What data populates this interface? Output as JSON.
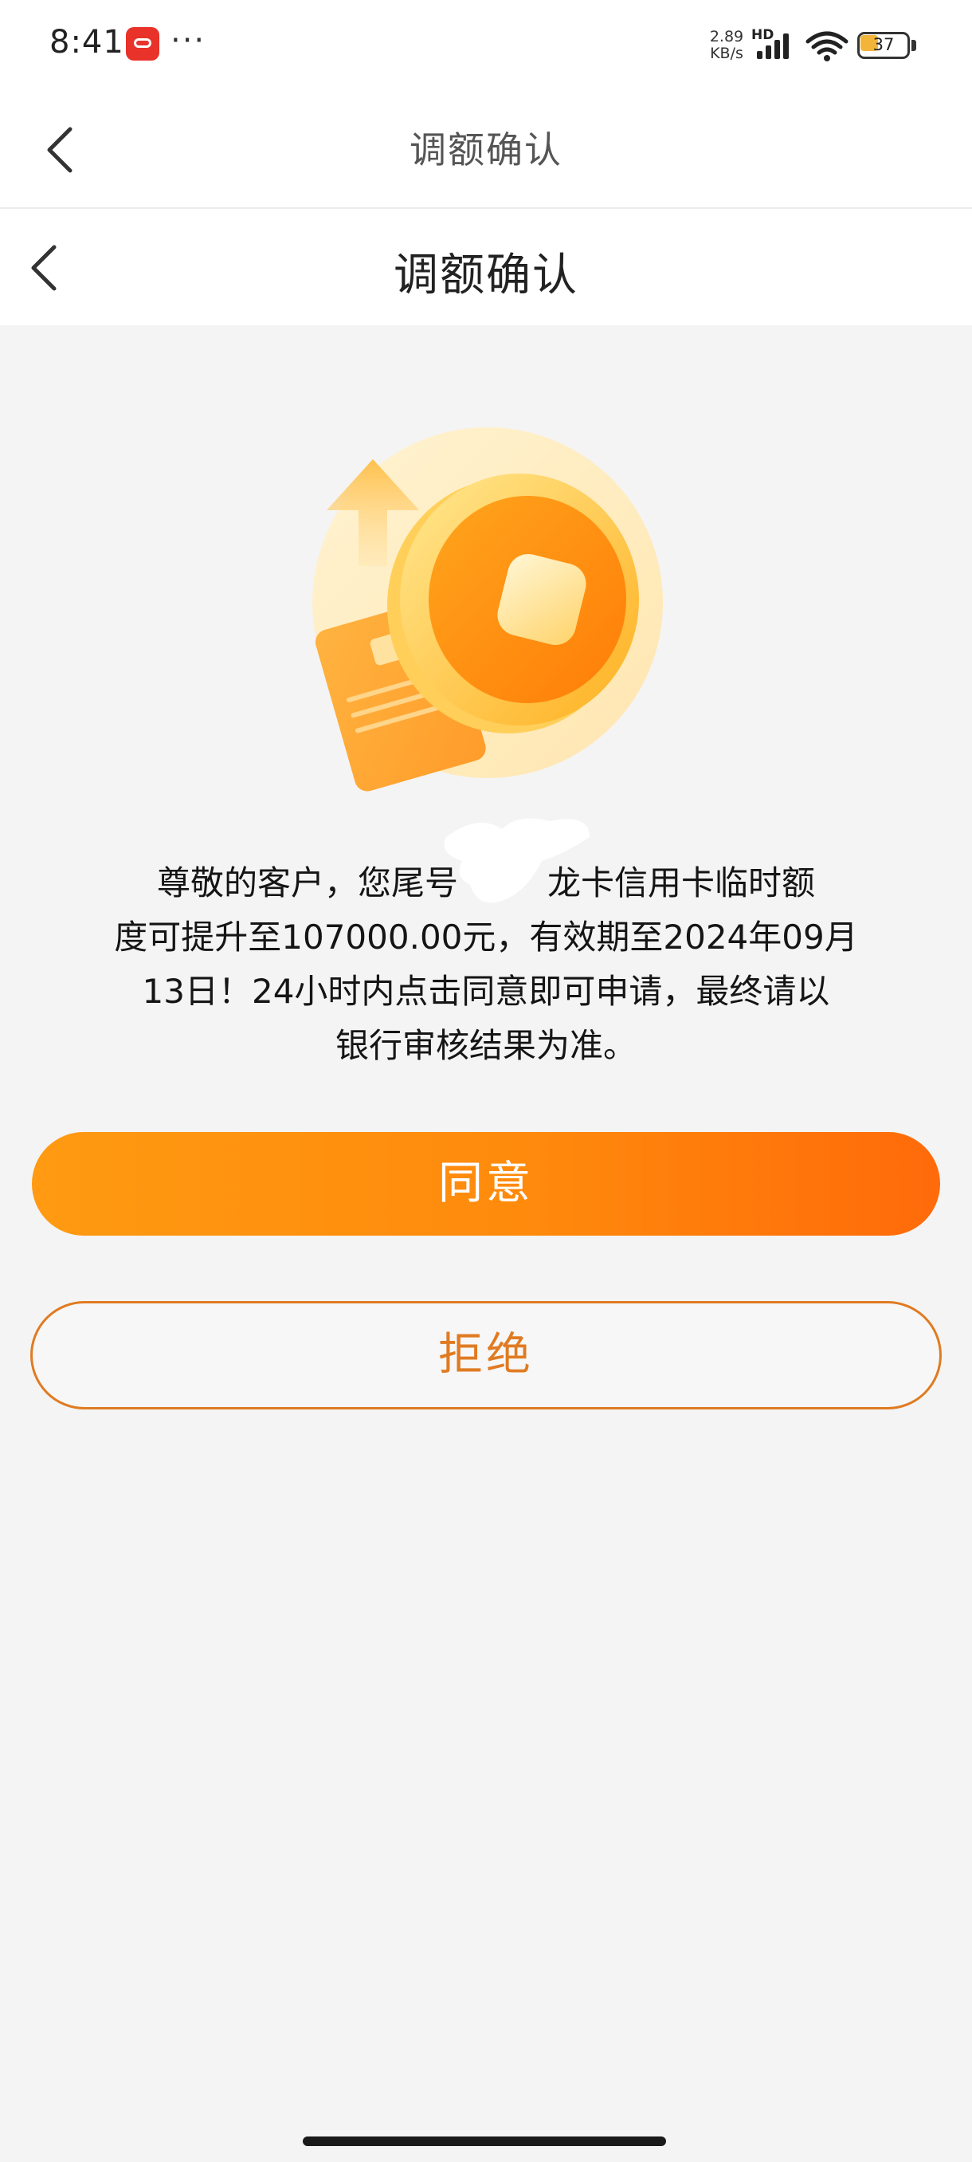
{
  "status_bar": {
    "time": "8:41",
    "more": "···",
    "network_speed_value": "2.89",
    "network_speed_unit": "KB/s",
    "hd_label": "HD",
    "battery_level": "37",
    "icons": [
      "app-notification-icon",
      "signal-icon",
      "wifi-icon",
      "battery-icon"
    ]
  },
  "nav_outer": {
    "title": "调额确认"
  },
  "nav_inner": {
    "title": "调额确认"
  },
  "message": {
    "line1_prefix": "尊敬的客户，您尾号",
    "line1_suffix": "龙卡信用卡临时额",
    "line2": "度可提升至107000.00元，有效期至2024年09月",
    "line3": "13日！24小时内点击同意即可申请，最终请以",
    "line4": "银行审核结果为准。"
  },
  "buttons": {
    "agree": "同意",
    "reject": "拒绝"
  },
  "colors": {
    "accent_orange": "#ff8a0c",
    "reject_border": "#e07b22",
    "background": "#f4f4f4"
  }
}
